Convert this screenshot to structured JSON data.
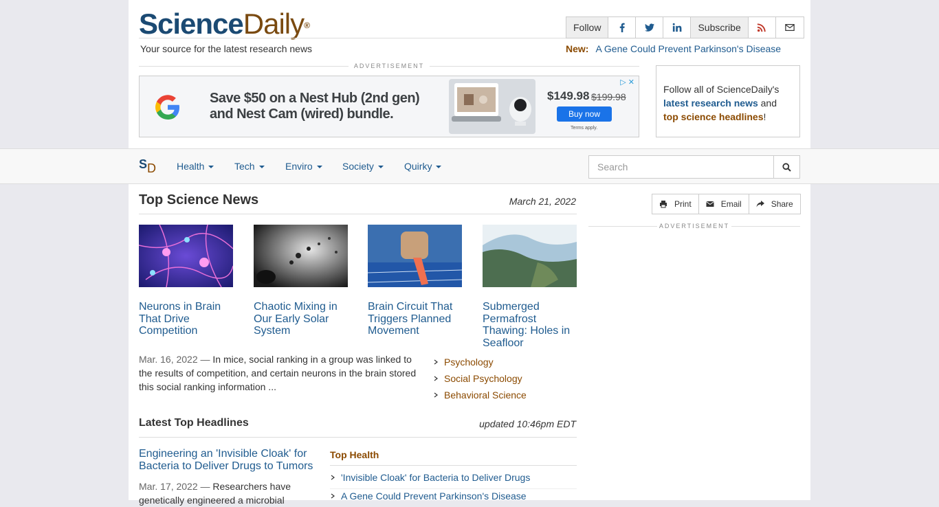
{
  "header": {
    "logo_science": "Science",
    "logo_daily": "Daily",
    "logo_reg": "®",
    "tagline": "Your source for the latest research news",
    "follow_label": "Follow",
    "subscribe_label": "Subscribe",
    "new_label": "New:",
    "new_headline": "A Gene Could Prevent Parkinson's Disease"
  },
  "ad": {
    "label": "ADVERTISEMENT",
    "headline_line1": "Save $50 on a Nest Hub (2nd gen)",
    "headline_line2": "and Nest Cam (wired) bundle.",
    "price": "$149.98",
    "old_price": "$199.98",
    "buy_label": "Buy now",
    "terms": "Terms apply."
  },
  "followbox": {
    "line_start": "Follow all of ScienceDaily's",
    "link1": "latest research news",
    "and": " and",
    "link2": "top science headlines",
    "end": "!"
  },
  "nav": {
    "logo_s": "S",
    "logo_d": "D",
    "items": [
      "Health",
      "Tech",
      "Enviro",
      "Society",
      "Quirky"
    ],
    "search_placeholder": "Search"
  },
  "top_news": {
    "title": "Top Science News",
    "date": "March 21, 2022",
    "tiles": [
      {
        "caption": "Neurons in Brain That Drive Competition"
      },
      {
        "caption": "Chaotic Mixing in Our Early Solar System"
      },
      {
        "caption": "Brain Circuit That Triggers Planned Movement"
      },
      {
        "caption": "Submerged Permafrost Thawing: Holes in Seafloor"
      }
    ],
    "summary_date": "Mar. 16, 2022",
    "summary_dash": " — ",
    "summary_text": "In mice, social ranking in a group was linked to the results of competition, and certain neurons in the brain stored this social ranking information ...",
    "topics": [
      "Psychology",
      "Social Psychology",
      "Behavioral Science"
    ]
  },
  "latest": {
    "title": "Latest Top Headlines",
    "updated": "updated 10:46pm EDT",
    "lead_link": "Engineering an 'Invisible Cloak' for Bacteria to Deliver Drugs to Tumors",
    "lead_date": "Mar. 17, 2022",
    "lead_dash": " — ",
    "lead_text": "Researchers have genetically engineered a microbial",
    "top_health_label": "Top Health",
    "health_items": [
      "'Invisible Cloak' for Bacteria to Deliver Drugs",
      "A Gene Could Prevent Parkinson's Disease"
    ]
  },
  "actions": {
    "print": "Print",
    "email": "Email",
    "share": "Share"
  },
  "right_ad_label": "ADVERTISEMENT",
  "colors": {
    "brand_blue": "#1b4a73",
    "link_blue": "#1f5b8f",
    "brand_brown": "#8b4a00"
  }
}
